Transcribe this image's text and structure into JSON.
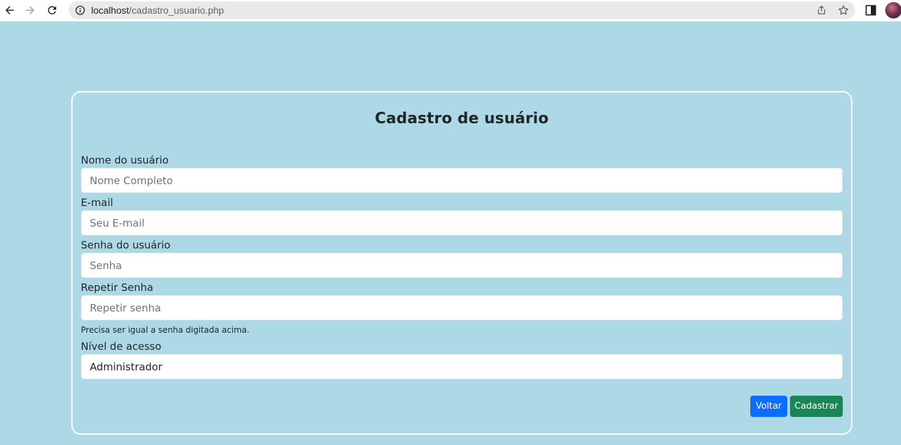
{
  "browser": {
    "url_host": "localhost",
    "url_path": "/cadastro_usuario.php"
  },
  "form": {
    "title": "Cadastro de usuário",
    "name_label": "Nome do usuário",
    "name_placeholder": "Nome Completo",
    "email_label": "E-mail",
    "email_placeholder": "Seu E-mail",
    "password_label": "Senha do usuário",
    "password_placeholder": "Senha",
    "repeat_label": "Repetir Senha",
    "repeat_placeholder": "Repetir senha",
    "repeat_help": "Precisa ser igual a senha digitada acima.",
    "access_label": "Nível de acesso",
    "access_value": "Administrador",
    "back_label": "Voltar",
    "submit_label": "Cadastrar"
  },
  "colors": {
    "page_bg": "#add8e6",
    "back_button": "#0d6efd",
    "submit_button": "#198754"
  }
}
